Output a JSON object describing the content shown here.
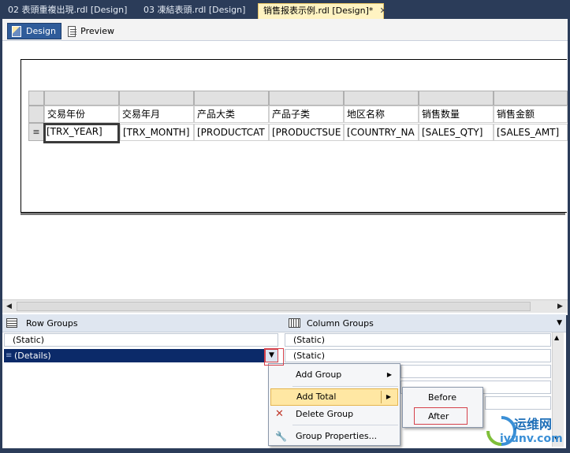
{
  "tabs": [
    {
      "label": "02 表頭重複出現.rdl [Design]"
    },
    {
      "label": "03 凍結表頭.rdl [Design]"
    },
    {
      "label": "销售报表示例.rdl [Design]*"
    }
  ],
  "view_tabs": {
    "design": "Design",
    "preview": "Preview"
  },
  "table": {
    "headers": [
      "交易年份",
      "交易年月",
      "产品大类",
      "产品子类",
      "地区名称",
      "销售数量",
      "销售金额"
    ],
    "row": [
      "[TRX_YEAR]",
      "[TRX_MONTH]",
      "[PRODUCTCAT",
      "[PRODUCTSUE",
      "[COUNTRY_NA",
      "[SALES_QTY]",
      "[SALES_AMT]"
    ]
  },
  "row_groups": {
    "title": "Row Groups",
    "items": [
      "(Static)",
      "(Details)"
    ]
  },
  "column_groups": {
    "title": "Column Groups",
    "items": [
      "(Static)",
      "(Static)"
    ]
  },
  "context_menu": [
    "Add Group",
    "Add Total",
    "Delete Group",
    "Group Properties..."
  ],
  "submenu": [
    "Before",
    "After"
  ],
  "watermark": {
    "brand": "运维网",
    "url": "iyunv.com"
  },
  "colors": {
    "selection": "#0b2a69",
    "menu_highlight": "#ffe7a3",
    "red_box": "#d5414b"
  }
}
